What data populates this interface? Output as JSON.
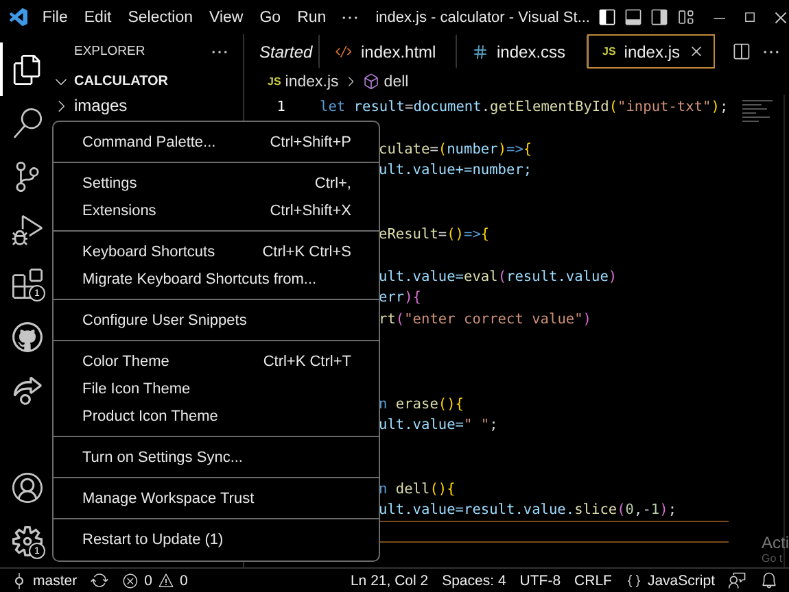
{
  "title_bar": {
    "menus": [
      "File",
      "Edit",
      "Selection",
      "View",
      "Go",
      "Run"
    ],
    "title": "index.js - calculator - Visual St..."
  },
  "activity_bar": {
    "items": [
      {
        "selected": true
      },
      {
        "selected": false
      },
      {
        "selected": false
      },
      {
        "selected": false
      },
      {
        "selected": false,
        "badge": "1"
      },
      {
        "selected": false
      },
      {
        "selected": false
      },
      {
        "selected": false
      },
      {
        "selected": false,
        "badge": "1"
      }
    ]
  },
  "sidebar": {
    "title": "EXPLORER",
    "folder": {
      "name": "CALCULATOR",
      "expanded": true,
      "children": [
        {
          "name": "images",
          "expanded": false
        }
      ]
    }
  },
  "tabs": [
    {
      "label": "Started",
      "kind": "preview",
      "selected": false
    },
    {
      "label": "index.html",
      "kind": "html",
      "selected": false
    },
    {
      "label": "index.css",
      "kind": "css",
      "selected": false
    },
    {
      "label": "index.js",
      "kind": "js",
      "file_badge": "JS",
      "selected": true
    }
  ],
  "breadcrumb": {
    "file_badge": "JS",
    "file": "index.js",
    "symbol": "dell"
  },
  "code_lines": [
    {
      "kind": "full",
      "number": "1",
      "tokens": [
        {
          "t": "let",
          "color": "#569cd6"
        },
        {
          "t": " result",
          "color": "#9cdcfe"
        },
        {
          "t": "=",
          "color": "#d4d4d4"
        },
        {
          "t": "document",
          "color": "#9cdcfe"
        },
        {
          "t": ".",
          "color": "#d4d4d4"
        },
        {
          "t": "getElementById",
          "color": "#dcdcaa"
        },
        {
          "t": "(",
          "color": "#ffd700"
        },
        {
          "t": "\"input-txt\"",
          "color": "#ce9178"
        },
        {
          "t": ")",
          "color": "#ffd700"
        },
        {
          "t": ";",
          "color": "#d4d4d4"
        }
      ]
    },
    {
      "kind": "blank"
    },
    {
      "kind": "covered",
      "tokens": [
        {
          "t": "culate",
          "color": "#dcdcaa"
        },
        {
          "t": "=",
          "color": "#d4d4d4"
        },
        {
          "t": "(",
          "color": "#ffd700"
        },
        {
          "t": "number",
          "color": "#9cdcfe"
        },
        {
          "t": ")",
          "color": "#ffd700"
        },
        {
          "t": "=>",
          "color": "#569cd6"
        },
        {
          "t": "{",
          "color": "#ffd700"
        }
      ]
    },
    {
      "kind": "covered",
      "tokens": [
        {
          "t": "ult.value+=number;",
          "color": "#9cdcfe"
        }
      ]
    },
    {
      "kind": "blank"
    },
    {
      "kind": "blank"
    },
    {
      "kind": "covered",
      "tokens": [
        {
          "t": "eResult",
          "color": "#dcdcaa"
        },
        {
          "t": "=",
          "color": "#d4d4d4"
        },
        {
          "t": "()",
          "color": "#ffd700"
        },
        {
          "t": "=>",
          "color": "#569cd6"
        },
        {
          "t": "{",
          "color": "#ffd700"
        }
      ]
    },
    {
      "kind": "blank"
    },
    {
      "kind": "covered",
      "tokens": [
        {
          "t": "ult.value=",
          "color": "#9cdcfe"
        },
        {
          "t": "eval",
          "color": "#dcdcaa"
        },
        {
          "t": "(",
          "color": "#da70d6"
        },
        {
          "t": "result.value",
          "color": "#9cdcfe"
        },
        {
          "t": ")",
          "color": "#da70d6"
        }
      ]
    },
    {
      "kind": "covered",
      "tokens": [
        {
          "t": "err",
          "color": "#9cdcfe"
        },
        {
          "t": "){",
          "color": "#da70d6"
        }
      ]
    },
    {
      "kind": "covered",
      "tokens": [
        {
          "t": "rt",
          "color": "#dcdcaa"
        },
        {
          "t": "(",
          "color": "#da70d6"
        },
        {
          "t": "\"enter correct value\"",
          "color": "#ce9178"
        },
        {
          "t": ")",
          "color": "#da70d6"
        }
      ]
    },
    {
      "kind": "blank"
    },
    {
      "kind": "blank"
    },
    {
      "kind": "blank"
    },
    {
      "kind": "covered",
      "tokens": [
        {
          "t": "n",
          "color": "#569cd6"
        },
        {
          "t": " erase",
          "color": "#dcdcaa"
        },
        {
          "t": "(){",
          "color": "#ffd700"
        }
      ]
    },
    {
      "kind": "covered",
      "tokens": [
        {
          "t": "ult.value=",
          "color": "#9cdcfe"
        },
        {
          "t": "\" \"",
          "color": "#ce9178"
        },
        {
          "t": ";",
          "color": "#d4d4d4"
        }
      ]
    },
    {
      "kind": "blank"
    },
    {
      "kind": "blank"
    },
    {
      "kind": "covered",
      "tokens": [
        {
          "t": "n",
          "color": "#569cd6"
        },
        {
          "t": " dell",
          "color": "#dcdcaa"
        },
        {
          "t": "(){",
          "color": "#ffd700"
        }
      ]
    },
    {
      "kind": "covered",
      "tokens": [
        {
          "t": "ult.value=result.value.",
          "color": "#9cdcfe"
        },
        {
          "t": "slice",
          "color": "#dcdcaa"
        },
        {
          "t": "(",
          "color": "#da70d6"
        },
        {
          "t": "0",
          "color": "#b5cea8"
        },
        {
          "t": ",-",
          "color": "#d4d4d4"
        },
        {
          "t": "1",
          "color": "#b5cea8"
        },
        {
          "t": ")",
          "color": "#da70d6"
        },
        {
          "t": ";",
          "color": "#d4d4d4"
        }
      ]
    },
    {
      "kind": "blank",
      "current": true
    }
  ],
  "menu": {
    "groups": [
      {
        "items": [
          {
            "label": "Command Palette...",
            "shortcut": "Ctrl+Shift+P"
          }
        ]
      },
      {
        "items": [
          {
            "label": "Settings",
            "shortcut": "Ctrl+,"
          },
          {
            "label": "Extensions",
            "shortcut": "Ctrl+Shift+X"
          }
        ]
      },
      {
        "items": [
          {
            "label": "Keyboard Shortcuts",
            "shortcut": "Ctrl+K Ctrl+S"
          },
          {
            "label": "Migrate Keyboard Shortcuts from..."
          }
        ]
      },
      {
        "items": [
          {
            "label": "Configure User Snippets"
          }
        ]
      },
      {
        "items": [
          {
            "label": "Color Theme",
            "shortcut": "Ctrl+K Ctrl+T"
          },
          {
            "label": "File Icon Theme"
          },
          {
            "label": "Product Icon Theme"
          }
        ]
      },
      {
        "items": [
          {
            "label": "Turn on Settings Sync..."
          }
        ]
      },
      {
        "items": [
          {
            "label": "Manage Workspace Trust"
          }
        ]
      },
      {
        "items": [
          {
            "label": "Restart to Update (1)"
          }
        ]
      }
    ]
  },
  "status_bar": {
    "branch": "master",
    "errors": "0",
    "warnings": "0",
    "position": "Ln 21, Col 2",
    "indentation": "Spaces: 4",
    "encoding": "UTF-8",
    "line_ending": "CRLF",
    "language": "JavaScript"
  },
  "notice": {
    "title": "Acti",
    "subtitle": "Go t"
  }
}
